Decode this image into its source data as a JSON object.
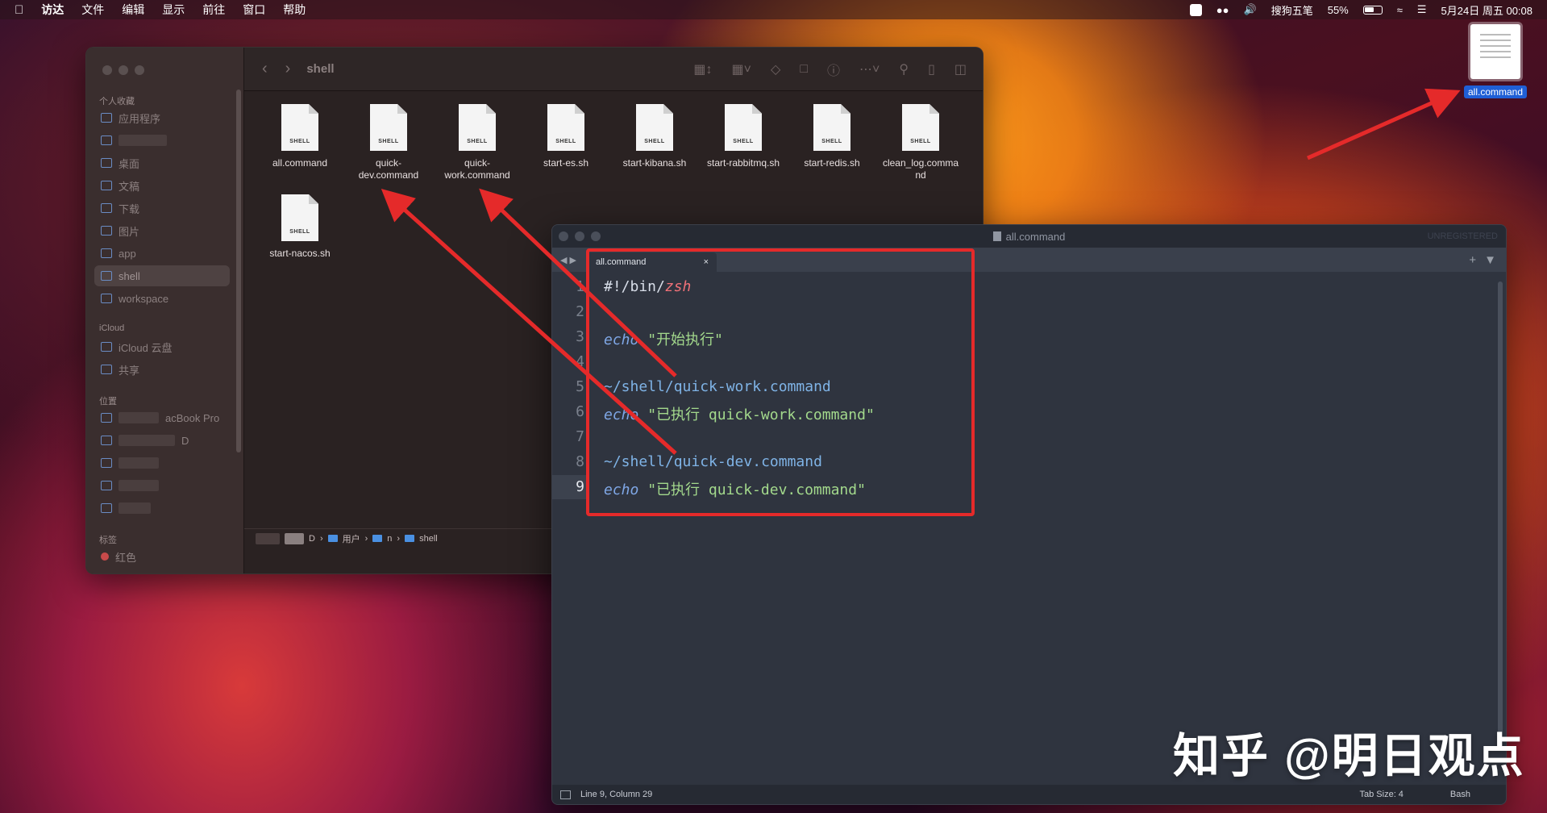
{
  "menubar": {
    "apple": "",
    "items": [
      "访达",
      "文件",
      "编辑",
      "显示",
      "前往",
      "窗口",
      "帮助"
    ],
    "ime": "搜狗五笔",
    "battery": "55%",
    "clock": "5月24日 周五 00:08"
  },
  "desktop": {
    "icon_label": "all.command"
  },
  "finder": {
    "title": "shell",
    "sections": {
      "favorites": "个人收藏",
      "icloud": "iCloud",
      "locations": "位置",
      "tags": "标签"
    },
    "sidebar_items": [
      "应用程序",
      "桌面",
      "文稿",
      "下载",
      "图片",
      "app",
      "shell",
      "workspace"
    ],
    "icloud_items": [
      "iCloud 云盘",
      "共享"
    ],
    "location_items": [
      "acBook Pro",
      "D"
    ],
    "tag_items": [
      "红色"
    ],
    "file_badge": "SHELL",
    "files": [
      "all.command",
      "quick-\ndev.command",
      "quick-\nwork.command",
      "start-es.sh",
      "start-kibana.sh",
      "start-rabbitmq.sh",
      "start-redis.sh",
      "clean_log.comma\nnd",
      "start-nacos.sh"
    ],
    "pathbar": [
      "D",
      "用户",
      "n",
      "shell"
    ]
  },
  "editor": {
    "title": "all.command",
    "unregistered": "UNREGISTERED",
    "tab": "all.command",
    "lines": [
      "1",
      "2",
      "3",
      "4",
      "5",
      "6",
      "7",
      "8",
      "9"
    ],
    "code": {
      "l1_a": "#!/bin/",
      "l1_b": "zsh",
      "l3_kw": "echo",
      "l3_str": "\"开始执行\"",
      "l5": "~/shell/quick-work.command",
      "l6_kw": "echo",
      "l6_str": "\"已执行 quick-work.command\"",
      "l8": "~/shell/quick-dev.command",
      "l9_kw": "echo",
      "l9_str": "\"已执行 quick-dev.command\""
    },
    "status": {
      "position": "Line 9, Column 29",
      "tab_size": "Tab Size: 4",
      "syntax": "Bash"
    }
  },
  "watermark": "知乎 @明日观点",
  "colors": {
    "annotation": "#e52a2a",
    "accent": "#1f5fd6"
  }
}
